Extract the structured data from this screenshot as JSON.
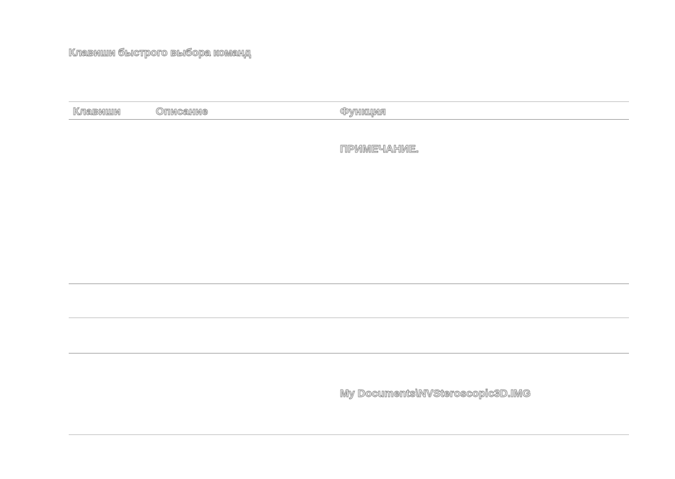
{
  "document": {
    "title": "Клавиши быстрого выбора команд"
  },
  "table": {
    "headers": {
      "keys": "Клавиши",
      "description": "Описание",
      "function": "Функция"
    },
    "note_label": "ПРИМЕЧАНИЕ.",
    "path": "My Documents\\NVSteroscopic3D.IMG"
  }
}
